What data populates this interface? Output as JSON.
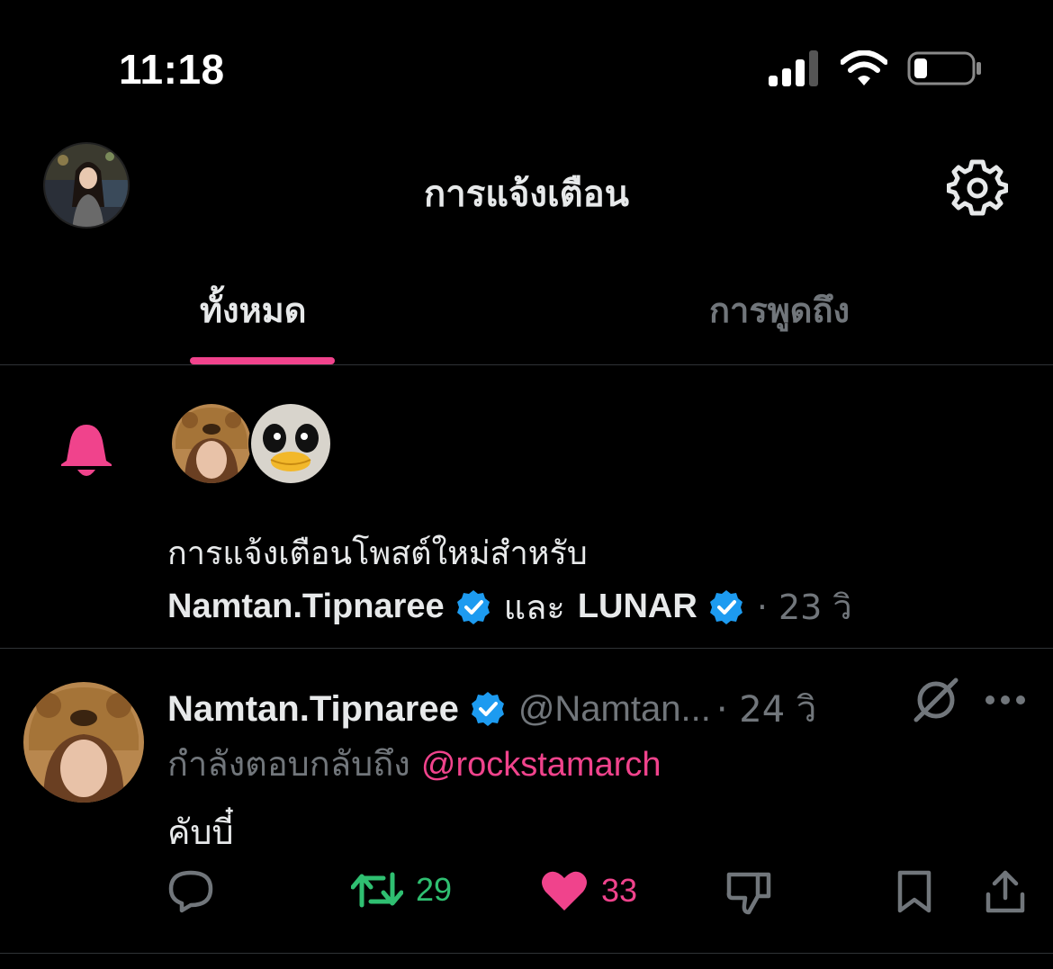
{
  "status_bar": {
    "time": "11:18",
    "icons": [
      "signal-icon",
      "wifi-icon",
      "battery-icon"
    ]
  },
  "header": {
    "title": "การแจ้งเตือน",
    "avatar": "profile-avatar",
    "settings_icon": "gear-icon"
  },
  "tabs": [
    {
      "label": "ทั้งหมด",
      "active": true
    },
    {
      "label": "การพูดถึง",
      "active": false
    }
  ],
  "notification": {
    "icon": "bell-icon",
    "text": "การแจ้งเตือนโพสต์ใหม่สำหรับ",
    "user1": "Namtan.Tipnaree",
    "joiner": "และ",
    "user2": "LUNAR",
    "time": "· 23 วิ"
  },
  "tweet": {
    "display_name": "Namtan.Tipnaree",
    "handle": "@Namtan...",
    "time": "· 24 วิ",
    "replying_prefix": "กำลังตอบกลับถึง",
    "replying_to": "@rockstamarch",
    "text": "คับบี๋",
    "retweets": "29",
    "likes": "33"
  },
  "colors": {
    "accent": "#f0438c",
    "retweet": "#2fbf71",
    "verified": "#1d9bf0",
    "muted": "#71767b",
    "background": "#000000"
  }
}
